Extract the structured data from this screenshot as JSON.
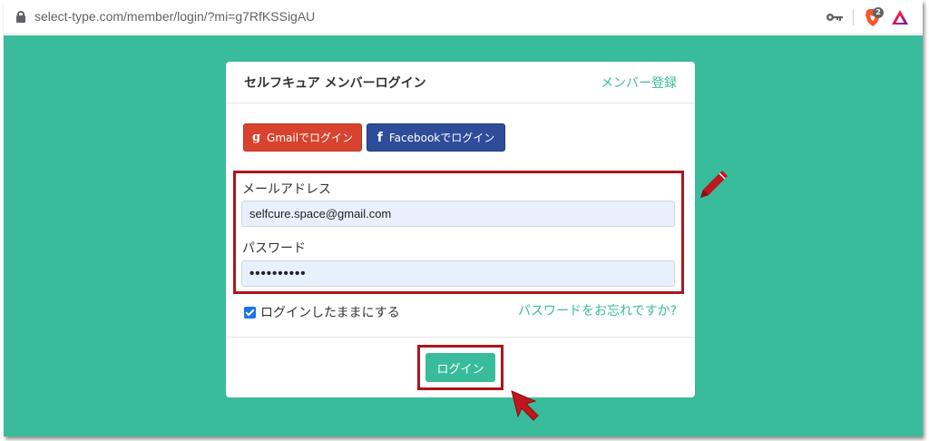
{
  "browser": {
    "url": "select-type.com/member/login/?mi=g7RfKSSigAU",
    "badge_count": "2",
    "icons": [
      "lock-icon",
      "key-icon",
      "brave-icon",
      "triangle-icon"
    ]
  },
  "card": {
    "title": "セルフキュア メンバーログイン",
    "register_link": "メンバー登録",
    "gmail_glyph": "g",
    "gmail_label": "Gmailでログイン",
    "facebook_glyph": "f",
    "facebook_label": "Facebookでログイン",
    "email_label": "メールアドレス",
    "email_value": "selfcure.space@gmail.com",
    "password_label": "パスワード",
    "password_value": "••••••••••",
    "remember_label": "ログインしたままにする",
    "remember_checked": true,
    "forgot_link": "パスワードをお忘れですか?",
    "login_button": "ログイン"
  },
  "annotations": {
    "highlight_color": "#b0141c",
    "icons": [
      "pencil-icon",
      "arrow-cursor-icon"
    ]
  },
  "colors": {
    "page_bg": "#39bc9b",
    "gmail": "#d8432f",
    "facebook": "#2e4c99",
    "accent": "#39bc9b"
  }
}
